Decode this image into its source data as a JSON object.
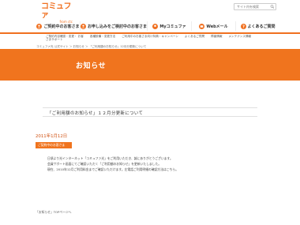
{
  "header": {
    "logo_main": "コミュファ",
    "logo_sub": "from ctc",
    "search_placeholder": "サイト内を検索"
  },
  "main_nav": [
    {
      "label": "ご契約中のお客さま"
    },
    {
      "label": "お申し込みをご検討中のお客さま"
    },
    {
      "label": "Myコミュファ"
    },
    {
      "label": "Webメール"
    },
    {
      "label": "よくあるご質問"
    }
  ],
  "sub_nav": [
    {
      "line1": "ご契約内容確認・変更・ お客",
      "line2": "さまサポート"
    },
    {
      "line1": "各種設備・変更方法",
      "line2": ""
    },
    {
      "line1": "ご利用中のお客さま向け特典・キャンペーン",
      "line2": ""
    },
    {
      "line1": "よくあるご質問",
      "line2": ""
    },
    {
      "line1": "障害情報",
      "line2": ""
    },
    {
      "line1": "メンテナンス情報",
      "line2": ""
    }
  ],
  "breadcrumb": "コミュファ光 公式サイト ＞ お知らせ ＞ 「ご利用額のお知らせ」12月分更新について",
  "banner": {
    "title": "お知らせ"
  },
  "article": {
    "heading": "「ご利用額のお知らせ」１２月分更新について",
    "date": "2011年1月12日",
    "tag": "ご契約中のお客さま",
    "body": [
      "日頃より光インターネット「コミュファ光」をご利用いただき、誠にありがとうございます。",
      "会員サポート画面にてご確認いただく「ご利用額のお知らせ」を更新いたしました。",
      "現在、2010年12月ご利用料金までご確認いただけます。左電話ご利用明細の確認方法はこちら。"
    ]
  },
  "footer": {
    "back_link": "「お知らせ」TOPページへ"
  },
  "colors": {
    "accent": "#f0741e"
  }
}
